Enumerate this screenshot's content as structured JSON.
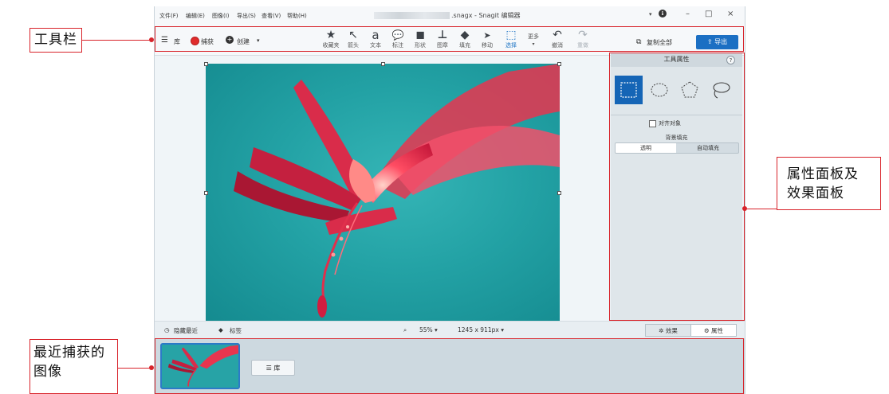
{
  "menu": [
    "文件(F)",
    "编辑(E)",
    "图像(I)",
    "导出(S)",
    "查看(V)",
    "帮助(H)"
  ],
  "title": ".snagx - Snagit 编辑器",
  "window_controls": {
    "info": "ℹ",
    "minimize": "–",
    "maximize": "□",
    "close": "×"
  },
  "toolbar": {
    "library": "库",
    "capture": "捕获",
    "create": "创建",
    "tools": [
      {
        "label": "收藏夹",
        "icon": "star-icon",
        "glyph": "★"
      },
      {
        "label": "箭头",
        "icon": "arrow-icon",
        "glyph": "↖"
      },
      {
        "label": "文本",
        "icon": "text-icon",
        "glyph": "a"
      },
      {
        "label": "标注",
        "icon": "callout-icon",
        "glyph": "💬"
      },
      {
        "label": "形状",
        "icon": "shape-icon",
        "glyph": "◼"
      },
      {
        "label": "图章",
        "icon": "stamp-icon",
        "glyph": "⊥"
      },
      {
        "label": "填充",
        "icon": "fill-icon",
        "glyph": "◆"
      },
      {
        "label": "移动",
        "icon": "move-icon",
        "glyph": "➤"
      },
      {
        "label": "选择",
        "icon": "select-icon",
        "glyph": "⬚"
      },
      {
        "label": "更多",
        "icon": "more-icon",
        "glyph": ""
      },
      {
        "label": "撤消",
        "icon": "undo-icon",
        "glyph": "↶"
      },
      {
        "label": "重做",
        "icon": "redo-icon",
        "glyph": "↷"
      }
    ],
    "copy_all": "复制全部",
    "export": "导出"
  },
  "properties": {
    "header": "工具属性",
    "help": "?",
    "align_objects": "对齐对象",
    "background_fill": "背景填充",
    "fill_options": [
      "透明",
      "自动填充"
    ]
  },
  "status": {
    "hide_recent": "隐藏最近",
    "tags": "标签",
    "zoom": "55% ▾",
    "dimensions": "1245 x 911px ▾",
    "effects": "效果",
    "props": "属性"
  },
  "tray": {
    "library": "库"
  },
  "annotations": {
    "toolbar": "工具栏",
    "panel_line1": "属性面板及",
    "panel_line2": "效果面板",
    "recent_line1": "最近捕获的",
    "recent_line2": "图像"
  },
  "colors": {
    "accent": "#1b6fc3",
    "annotation": "#d8232a",
    "canvas_bg": "#23a2a5"
  }
}
